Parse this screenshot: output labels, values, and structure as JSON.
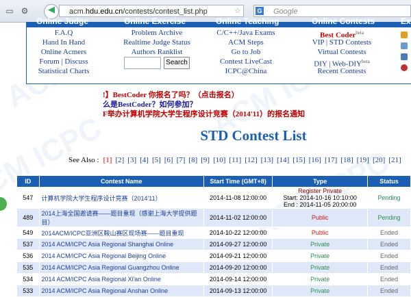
{
  "browser": {
    "url_prefix": "acm.",
    "url_domain": "hdu.edu.cn",
    "url_path": "/contests/contest_list.php",
    "search_placeholder": "Google",
    "search_engine_label": "G",
    "back_glyph": "◀"
  },
  "nav": {
    "headers": [
      "Online Judge",
      "Online Exercise",
      "Online Teaching",
      "Online Contests",
      "Ex"
    ],
    "judge": [
      "F.A.Q",
      "Hand In Hand",
      "Online Acmers",
      "Forum | Discuss",
      "Statistical Charts"
    ],
    "exercise": [
      "Problem Archive",
      "Realtime Judge Status",
      "Authors Ranklist"
    ],
    "search_button": "Search",
    "teaching": [
      "C/C++/Java Exams",
      "ACM Steps",
      "Go to Job",
      "Contest LiveCast",
      "ICPC@China"
    ],
    "contests": {
      "bestcoder": "Best Coder",
      "bestcoder_sup": "beta",
      "items": [
        "VIP | STD Contests",
        "Virtual Contests",
        "DIY | Web-DIY"
      ],
      "diy_sup": "beta",
      "recent": "Recent Contests"
    }
  },
  "notices": [
    {
      "text": "!】BestCoder 你报名了吗？（点击报名）",
      "color": "#c00000"
    },
    {
      "text": "么是BestCoder？如何参加？",
      "color": "#1a1a9b"
    },
    {
      "text": "F举办计算机学院大学生程序设计竞赛（2014'11）的报名通知",
      "color": "#c00000"
    }
  ],
  "page_title": "STD Contest List",
  "see_also": {
    "label": "See Also :",
    "pages": [
      "[1]",
      "[2]",
      "[3]",
      "[4]",
      "[5]",
      "[6]",
      "[7]",
      "[8]",
      "[9]",
      "[10]",
      "[11]",
      "[12]",
      "[13]",
      "[14]",
      "[15]",
      "[16]",
      "[17]",
      "[18]",
      "[19]",
      "[20]",
      "[21]"
    ]
  },
  "table": {
    "headers": [
      "ID",
      "Contest Name",
      "Start Time (GMT+8)",
      "Type",
      "Status"
    ],
    "rows": [
      {
        "id": "547",
        "name": "计算机学院大学生程序设计竞赛（2014'11）",
        "time": "2014-11-08 12:00:00",
        "type_lines": [
          "Register Private",
          "Start: 2014-10-16 10:10:00",
          "End : 2014-11-05 20:00:00"
        ],
        "type_color": "#8b0000",
        "status": "Pending",
        "status_color": "#2e8b57"
      },
      {
        "id": "489",
        "name": "2014上海全国邀请赛——题目重现（感谢上海大学提供题目）",
        "time": "2014-11-02 12:00:00",
        "type_lines": [
          "Public"
        ],
        "type_color": "#d01010",
        "status": "Pending",
        "status_color": "#2e8b57"
      },
      {
        "id": "549",
        "name": "2014ACM/ICPC亚洲区鞍山赛区现场赛——题目重现",
        "time": "2014-10-22 12:00:00",
        "type_lines": [
          "Public"
        ],
        "type_color": "#d01010",
        "status": "Ended",
        "status_color": "#666666"
      },
      {
        "id": "537",
        "name": "2014 ACM/ICPC Asia Regional Shanghai Online",
        "time": "2014-09-27 12:00:00",
        "type_lines": [
          "Private"
        ],
        "type_color": "#2e8b57",
        "status": "Ended",
        "status_color": "#666666"
      },
      {
        "id": "536",
        "name": "2014 ACM/ICPC Asia Regional Beijing Online",
        "time": "2014-09-21 12:00:00",
        "type_lines": [
          "Private"
        ],
        "type_color": "#2e8b57",
        "status": "Ended",
        "status_color": "#666666"
      },
      {
        "id": "535",
        "name": "2014 ACM/ICPC Asia Regional Guangzhou Online",
        "time": "2014-09-20 12:00:00",
        "type_lines": [
          "Private"
        ],
        "type_color": "#2e8b57",
        "status": "Ended",
        "status_color": "#666666"
      },
      {
        "id": "534",
        "name": "2014 ACM/ICPC Asia Regional Xi'an Online",
        "time": "2014-09-14 12:00:00",
        "type_lines": [
          "Private"
        ],
        "type_color": "#2e8b57",
        "status": "Ended",
        "status_color": "#666666"
      },
      {
        "id": "533",
        "name": "2014 ACM/ICPC Asia Regional Anshan Online",
        "time": "2014-09-13 12:00:00",
        "type_lines": [
          "Private"
        ],
        "type_color": "#2e8b57",
        "status": "Ended",
        "status_color": "#666666"
      }
    ]
  },
  "watermark_text": "ACM ICPC"
}
